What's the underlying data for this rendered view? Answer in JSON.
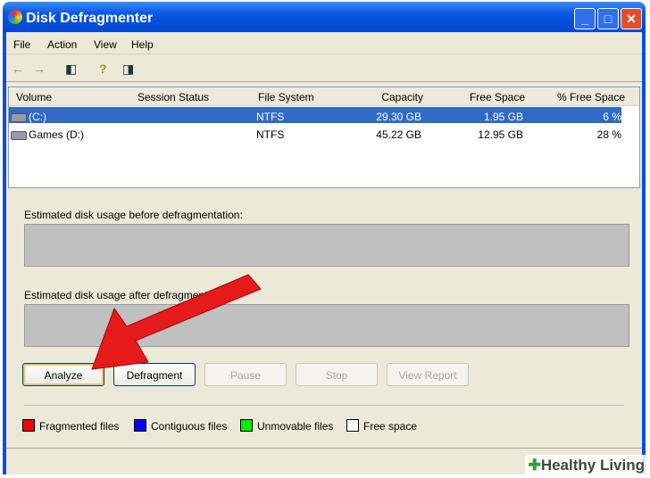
{
  "window": {
    "title": "Disk Defragmenter",
    "min": "_",
    "max": "□",
    "close": "✕"
  },
  "menu": [
    "File",
    "Action",
    "View",
    "Help"
  ],
  "toolbar": {
    "back": "←",
    "forward": "→",
    "show_hide": "◧",
    "help": "?",
    "pane": "◨"
  },
  "columns": [
    "Volume",
    "Session Status",
    "File System",
    "Capacity",
    "Free Space",
    "% Free Space"
  ],
  "volumes": [
    {
      "volume": "(C:)",
      "status": "",
      "fs": "NTFS",
      "capacity": "29.30 GB",
      "free": "1.95 GB",
      "pct": "6 %",
      "selected": true
    },
    {
      "volume": "Games (D:)",
      "status": "",
      "fs": "NTFS",
      "capacity": "45.22 GB",
      "free": "12.95 GB",
      "pct": "28 %",
      "selected": false
    }
  ],
  "before_label": "Estimated disk usage before defragmentation:",
  "after_label": "Estimated disk usage after defragmentation:",
  "buttons": {
    "analyze": "Analyze",
    "defragment": "Defragment",
    "pause": "Pause",
    "stop": "Stop",
    "report": "View Report"
  },
  "legend": [
    {
      "label": "Fragmented files",
      "color": "#ff0000"
    },
    {
      "label": "Contiguous files",
      "color": "#0000ff"
    },
    {
      "label": "Unmovable files",
      "color": "#00e000"
    },
    {
      "label": "Free space",
      "color": "#ffffff"
    }
  ],
  "watermark": "Healthy Living"
}
